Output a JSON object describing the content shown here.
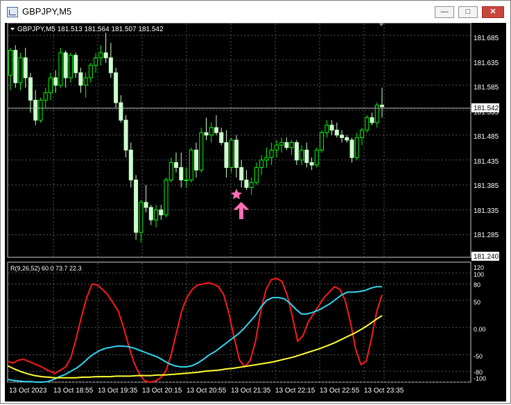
{
  "window": {
    "title": "GBPJPY,M5",
    "buttons": {
      "minimize": "minimize-icon",
      "maximize": "maximize-icon",
      "close": "close-icon"
    }
  },
  "main_chart": {
    "symbol_line": "GBPJPY,M5  181.513 181.564 181.507 181.542",
    "price_ticks": [
      "181.685",
      "181.635",
      "181.585",
      "181.535",
      "181.485",
      "181.435",
      "181.385",
      "181.335",
      "181.285"
    ],
    "current_price": "181.542",
    "bottom_price": "181.240",
    "markers": {
      "star": "star-icon",
      "arrow": "up-arrow-icon"
    },
    "colors": {
      "bull": "#00ff00",
      "bear": "#ccffcc",
      "star": "#ff6eb4",
      "arrow": "#ff6eb4",
      "grid": "#5a5a5a"
    }
  },
  "indicator": {
    "label": "R(9,26,52) 60.0 73.7 22.3",
    "ticks": [
      "120",
      "100",
      "80",
      "50",
      "0.00",
      "-50",
      "-80",
      "-100"
    ],
    "colors": {
      "red": "#ff1a1a",
      "cyan": "#33d6f0",
      "yellow": "#ffff33"
    }
  },
  "time_axis": [
    "13 Oct 2023",
    "13 Oct 18:55",
    "13 Oct 19:35",
    "13 Oct 20:15",
    "13 Oct 20:55",
    "13 Oct 21:35",
    "13 Oct 22:15",
    "13 Oct 22:55",
    "13 Oct 23:35"
  ],
  "chart_data": {
    "type": "candlestick",
    "y_range": [
      181.24,
      181.71
    ],
    "indicator_range": [
      -100,
      120
    ],
    "candles": [
      [
        181.605,
        181.66,
        181.575,
        181.655
      ],
      [
        181.655,
        181.665,
        181.58,
        181.59
      ],
      [
        181.59,
        181.65,
        181.575,
        181.64
      ],
      [
        181.64,
        181.66,
        181.58,
        181.6
      ],
      [
        181.6,
        181.61,
        181.53,
        181.555
      ],
      [
        181.555,
        181.575,
        181.505,
        181.515
      ],
      [
        181.515,
        181.56,
        181.51,
        181.555
      ],
      [
        181.555,
        181.58,
        181.54,
        181.57
      ],
      [
        181.57,
        181.61,
        181.555,
        181.6
      ],
      [
        181.6,
        181.615,
        181.57,
        181.585
      ],
      [
        181.585,
        181.66,
        181.58,
        181.65
      ],
      [
        181.65,
        181.655,
        181.58,
        181.6
      ],
      [
        181.6,
        181.65,
        181.59,
        181.645
      ],
      [
        181.645,
        181.65,
        181.6,
        181.61
      ],
      [
        181.61,
        181.62,
        181.57,
        181.585
      ],
      [
        181.585,
        181.61,
        181.56,
        181.6
      ],
      [
        181.6,
        181.63,
        181.59,
        181.625
      ],
      [
        181.625,
        181.65,
        181.61,
        181.64
      ],
      [
        181.64,
        181.665,
        181.625,
        181.65
      ],
      [
        181.65,
        181.69,
        181.63,
        181.64
      ],
      [
        181.64,
        181.67,
        181.6,
        181.61
      ],
      [
        181.61,
        181.62,
        181.54,
        181.55
      ],
      [
        181.55,
        181.565,
        181.51,
        181.515
      ],
      [
        181.515,
        181.525,
        181.44,
        181.455
      ],
      [
        181.455,
        181.47,
        181.38,
        181.395
      ],
      [
        181.395,
        181.405,
        181.275,
        181.29
      ],
      [
        181.29,
        181.355,
        181.27,
        181.35
      ],
      [
        181.35,
        181.385,
        181.33,
        181.34
      ],
      [
        181.34,
        181.345,
        181.305,
        181.315
      ],
      [
        181.315,
        181.345,
        181.3,
        181.335
      ],
      [
        181.335,
        181.345,
        181.315,
        181.325
      ],
      [
        181.325,
        181.4,
        181.32,
        181.395
      ],
      [
        181.395,
        181.44,
        181.39,
        181.43
      ],
      [
        181.43,
        181.45,
        181.41,
        181.42
      ],
      [
        181.42,
        181.45,
        181.38,
        181.395
      ],
      [
        181.395,
        181.42,
        181.38,
        181.395
      ],
      [
        181.395,
        181.46,
        181.39,
        181.455
      ],
      [
        181.455,
        181.47,
        181.4,
        181.415
      ],
      [
        181.415,
        181.5,
        181.41,
        181.49
      ],
      [
        181.49,
        181.52,
        181.475,
        181.485
      ],
      [
        181.485,
        181.51,
        181.47,
        181.5
      ],
      [
        181.5,
        181.525,
        181.485,
        181.49
      ],
      [
        181.49,
        181.5,
        181.465,
        181.47
      ],
      [
        181.47,
        181.495,
        181.4,
        181.42
      ],
      [
        181.42,
        181.48,
        181.41,
        181.475
      ],
      [
        181.475,
        181.485,
        181.4,
        181.42
      ],
      [
        181.42,
        181.435,
        181.38,
        181.395
      ],
      [
        181.395,
        181.415,
        181.375,
        181.38
      ],
      [
        181.38,
        181.4,
        181.365,
        181.39
      ],
      [
        181.39,
        181.43,
        181.385,
        181.42
      ],
      [
        181.42,
        181.445,
        181.405,
        181.435
      ],
      [
        181.435,
        181.46,
        181.42,
        181.44
      ],
      [
        181.44,
        181.47,
        181.425,
        181.455
      ],
      [
        181.455,
        181.475,
        181.44,
        181.465
      ],
      [
        181.465,
        181.48,
        181.45,
        181.47
      ],
      [
        181.47,
        181.48,
        181.455,
        181.46
      ],
      [
        181.46,
        181.475,
        181.445,
        181.47
      ],
      [
        181.47,
        181.475,
        181.425,
        181.435
      ],
      [
        181.435,
        181.465,
        181.425,
        181.455
      ],
      [
        181.455,
        181.47,
        181.42,
        181.43
      ],
      [
        181.43,
        181.44,
        181.415,
        181.425
      ],
      [
        181.425,
        181.46,
        181.42,
        181.455
      ],
      [
        181.455,
        181.495,
        181.45,
        181.49
      ],
      [
        181.49,
        181.515,
        181.48,
        181.505
      ],
      [
        181.505,
        181.515,
        181.485,
        181.495
      ],
      [
        181.495,
        181.51,
        181.48,
        181.485
      ],
      [
        181.485,
        181.495,
        181.47,
        181.48
      ],
      [
        181.48,
        181.485,
        181.47,
        181.475
      ],
      [
        181.475,
        181.48,
        181.43,
        181.44
      ],
      [
        181.44,
        181.49,
        181.435,
        181.48
      ],
      [
        181.48,
        181.5,
        181.465,
        181.495
      ],
      [
        181.495,
        181.525,
        181.49,
        181.52
      ],
      [
        181.52,
        181.53,
        181.505,
        181.51
      ],
      [
        181.51,
        181.55,
        181.5,
        181.545
      ],
      [
        181.545,
        181.58,
        181.52,
        181.542
      ]
    ],
    "series": [
      {
        "values": [
          -62,
          -65,
          -60,
          -58,
          -62,
          -66,
          -70,
          -75,
          -80,
          -84,
          -78,
          -72,
          -55,
          -20,
          20,
          55,
          80,
          78,
          70,
          60,
          45,
          30,
          0,
          -35,
          -65,
          -85,
          -98,
          -100,
          -98,
          -92,
          -80,
          -50,
          -10,
          30,
          55,
          70,
          78,
          80,
          82,
          80,
          75,
          60,
          25,
          -20,
          -60,
          -72,
          -60,
          -25,
          30,
          70,
          88,
          90,
          85,
          60,
          20,
          -25,
          -15,
          10,
          25,
          40,
          55,
          65,
          75,
          70,
          50,
          10,
          -40,
          -68,
          -62,
          -20,
          30,
          60
        ]
      },
      {
        "values": [
          -95,
          -97,
          -98,
          -99,
          -99,
          -100,
          -100,
          -99,
          -95,
          -90,
          -86,
          -80,
          -74,
          -66,
          -56,
          -48,
          -42,
          -38,
          -36,
          -34,
          -34,
          -35,
          -38,
          -42,
          -46,
          -50,
          -54,
          -60,
          -66,
          -70,
          -72,
          -72,
          -70,
          -65,
          -58,
          -50,
          -44,
          -36,
          -28,
          -20,
          -12,
          -2,
          10,
          22,
          38,
          50,
          55,
          55,
          53,
          45,
          34,
          25,
          25,
          28,
          32,
          38,
          44,
          52,
          60,
          65,
          65,
          66,
          68,
          72,
          75,
          75
        ]
      },
      {
        "values": [
          -70,
          -76,
          -81,
          -85,
          -88,
          -90,
          -91,
          -92,
          -92,
          -92,
          -92,
          -91,
          -91,
          -90,
          -90,
          -90,
          -89,
          -89,
          -89,
          -88,
          -88,
          -88,
          -87,
          -87,
          -86,
          -85,
          -84,
          -83,
          -82,
          -80,
          -79,
          -78,
          -76,
          -75,
          -73,
          -71,
          -69,
          -67,
          -65,
          -63,
          -60,
          -57,
          -54,
          -50,
          -46,
          -42,
          -38,
          -33,
          -28,
          -22,
          -16,
          -10,
          -3,
          5,
          14,
          22
        ]
      }
    ]
  }
}
